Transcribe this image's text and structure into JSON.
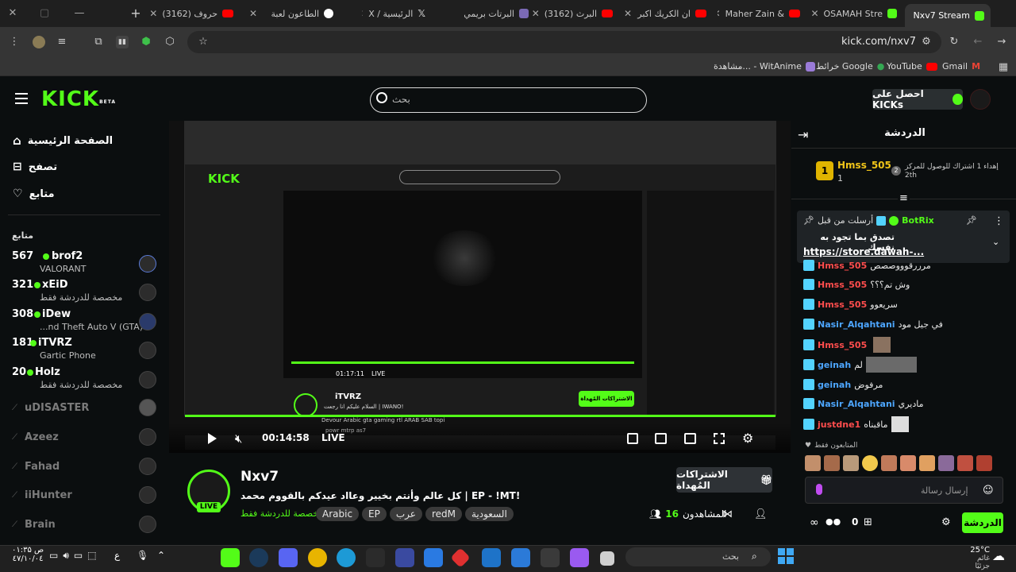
{
  "browser": {
    "tabs": [
      {
        "title": "Nxv7 Stream",
        "active": true
      },
      {
        "title": "OSAMAH Stre"
      },
      {
        "title": "Maher Zain &"
      },
      {
        "title": "ان الكريك اكبر"
      },
      {
        "title": "(3162) البرث"
      },
      {
        "title": "البرتات بريمي"
      },
      {
        "title": "X / الرئيسية"
      },
      {
        "title": "الطاعون لعبة"
      },
      {
        "title": "(3162) حروف"
      }
    ],
    "new_tab": "+",
    "url": "kick.com/nxv7",
    "bookmarks": [
      "Gmail",
      "YouTube",
      "خرائط Google",
      "مشاهدة... - WitAnime"
    ]
  },
  "kick": {
    "logo": "KICK",
    "logo_beta": "BETA",
    "search_placeholder": "بحث",
    "get_kicks": "احصل على KICKs"
  },
  "sidebar": {
    "nav": [
      {
        "label": "الصفحة الرئيسية"
      },
      {
        "label": "تصفح"
      },
      {
        "label": "متابع"
      }
    ],
    "following_header": "متابع",
    "channels": [
      {
        "count": "567",
        "name": "brof2",
        "game": "VALORANT"
      },
      {
        "count": "321",
        "name": "xEiD",
        "game": "مخصصة للدردشة فقط"
      },
      {
        "count": "308",
        "name": "iDew",
        "game": "...nd Theft Auto V (GTA)"
      },
      {
        "count": "181",
        "name": "iTVRZ",
        "game": "Gartic Phone"
      },
      {
        "count": "20",
        "name": "Holz",
        "game": "مخصصة للدردشة فقط"
      }
    ],
    "offline": [
      "uDISASTER",
      "Azeez",
      "Fahad",
      "iiHunter",
      "Brain"
    ]
  },
  "player": {
    "inner_name": "iTVRZ",
    "inner_title": "السلام عليكم انا رجعت | IWANO!",
    "inner_time": "01:17:11",
    "inner_live": "LIVE",
    "inner_sub_btn": "الاشتراكات المُهداة",
    "inner_tags": [
      "Devour",
      "Arabic",
      "gta",
      "gaming",
      "rtl",
      "ARAB",
      "SAB",
      "topi",
      "powr",
      "mtrp",
      "as7"
    ],
    "time": "00:14:58",
    "live": "LIVE"
  },
  "stream": {
    "name": "Nxv7",
    "title": "كل عالم وأنتم بخيير وعااد عيدكم بالقووم محمد | EP - !MT!",
    "category": "مخصصة للدردشة فقط",
    "tags": [
      "السعودية",
      "redM",
      "عرب",
      "EP",
      "Arabic"
    ],
    "viewers_label": "المشاهدون",
    "viewers": "16",
    "live_badge": "LIVE",
    "gift_button": "الاشتراكات المُهداة"
  },
  "chat": {
    "title": "الدردشة",
    "top_gifter": {
      "rank": "1",
      "name": "Hmss_505",
      "count": "1"
    },
    "top_text": "إهداء 1 اشتراك للوصول للمركز 2th",
    "top_rank2": "2",
    "pinned": {
      "by_label": "أرسلت من قبل",
      "user": "BotRix",
      "text": "تصدق بما تجود به نفسك",
      "link": "https://store.dawah-..."
    },
    "messages": [
      {
        "user": "Hmss_505",
        "color": "#ff4d4d",
        "text": "مرررقوووصصص"
      },
      {
        "user": "Hmss_505",
        "color": "#ff4d4d",
        "text": "وش تم؟؟؟"
      },
      {
        "user": "Hmss_505",
        "color": "#ff4d4d",
        "text": "سريعوو"
      },
      {
        "user": "Nasir_Alqahtani",
        "color": "#4da6ff",
        "text": "في جيل مود"
      },
      {
        "user": "Hmss_505",
        "color": "#ff4d4d",
        "text": ""
      },
      {
        "user": "geinah",
        "color": "#4da6ff",
        "text": "لم"
      },
      {
        "user": "geinah",
        "color": "#4da6ff",
        "text": "مرفوض"
      },
      {
        "user": "Nasir_Alqahtani",
        "color": "#4da6ff",
        "text": "ماديري"
      },
      {
        "user": "justdne1",
        "color": "#ff4d4d",
        "text": "ماقبناه"
      }
    ],
    "subs_only": "المتابعون فقط",
    "input_placeholder": "إرسال رسالة",
    "send_button": "الدردشة",
    "points": "0"
  },
  "taskbar": {
    "search_placeholder": "بحث",
    "weather_temp": "25°C",
    "weather_text": "غائم جزئيًا",
    "time": "۰۱:۳۵ ص",
    "date": "٤٧/١٠/٠٤",
    "lang": "ع"
  },
  "colors": {
    "accent": "#53fc18",
    "bg": "#0b0e0f"
  }
}
